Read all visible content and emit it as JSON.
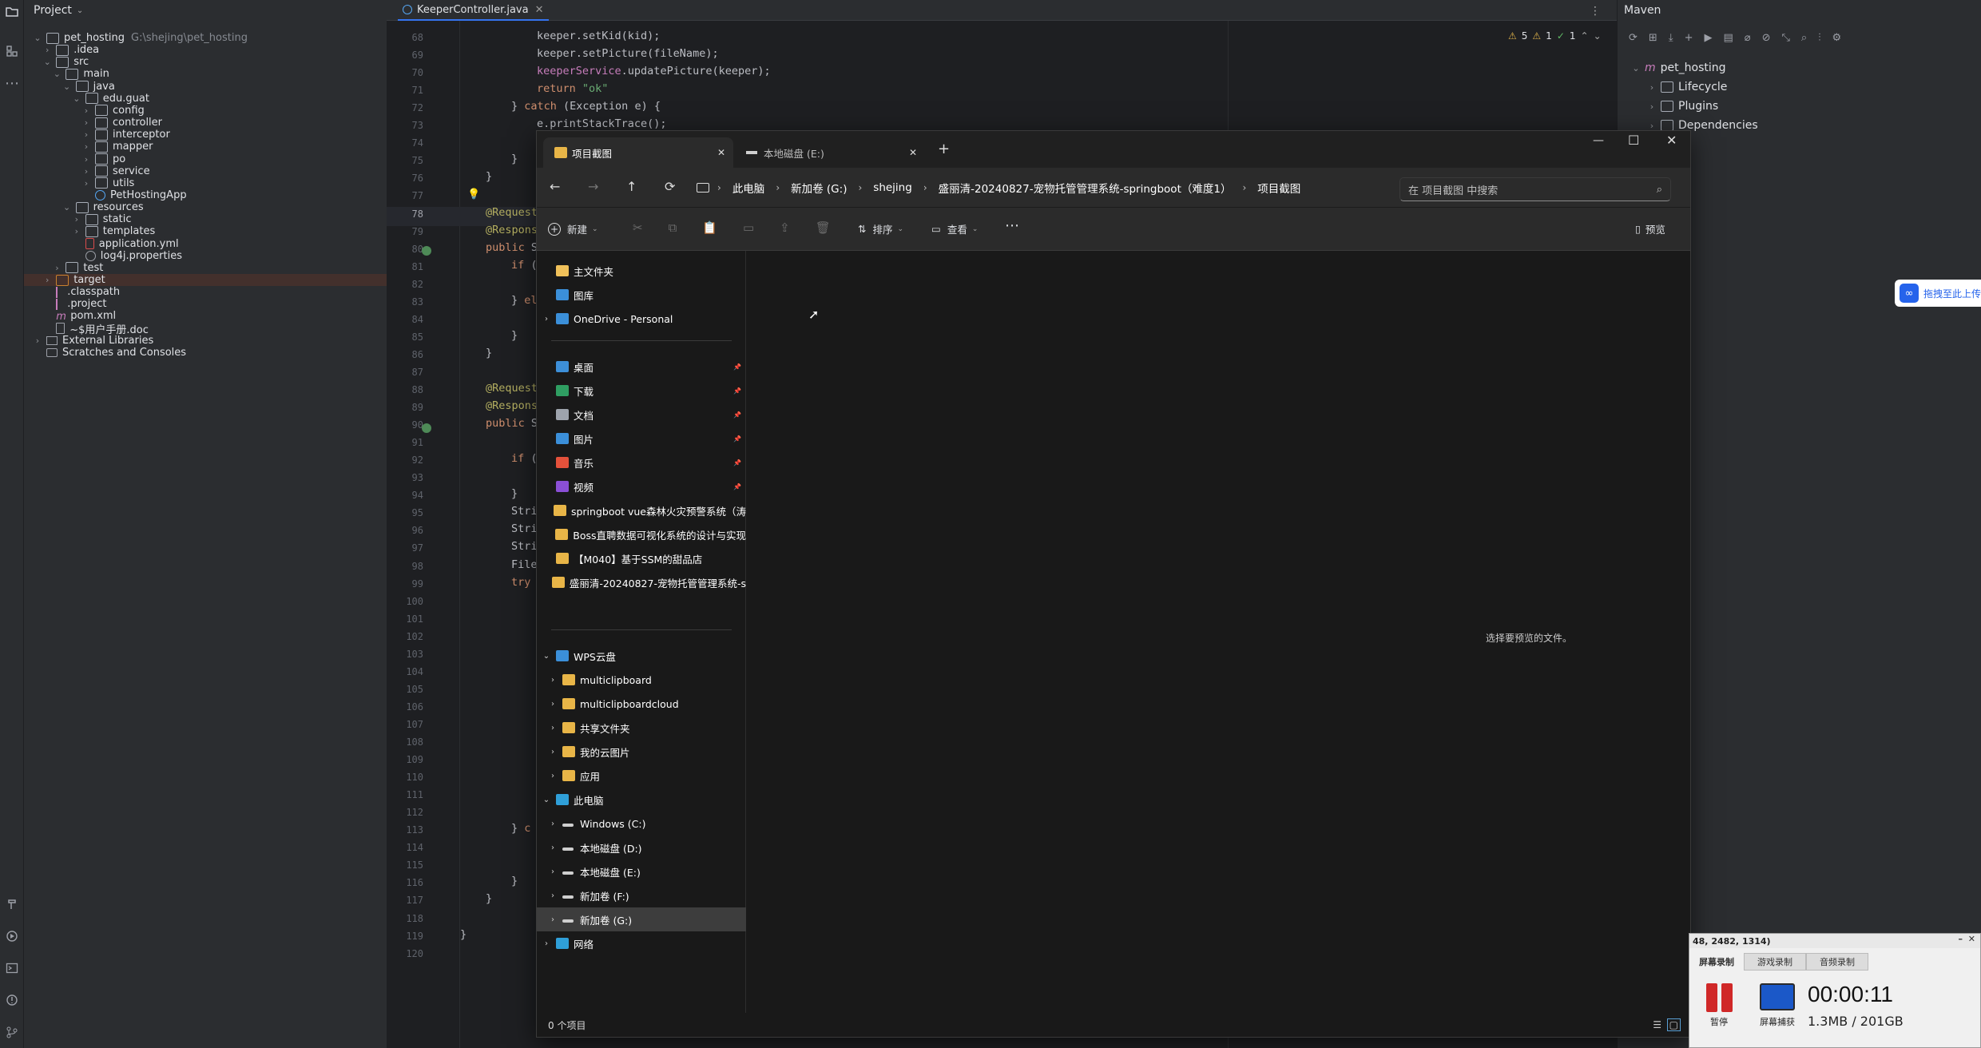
{
  "ide": {
    "project_label": "Project",
    "root": {
      "name": "pet_hosting",
      "path": "G:\\shejing\\pet_hosting"
    },
    "tree": [
      "pet_hosting",
      ".idea",
      "src",
      "main",
      "java",
      "edu.guat",
      "config",
      "controller",
      "interceptor",
      "mapper",
      "po",
      "service",
      "utils",
      "PetHostingApp",
      "resources",
      "static",
      "templates",
      "application.yml",
      "log4j.properties",
      "test",
      "target",
      ".classpath",
      ".project",
      "pom.xml",
      "~$用户手册.doc",
      "External Libraries",
      "Scratches and Consoles"
    ],
    "editor_tab": "KeeperController.java",
    "inspections": {
      "warnings": "5",
      "weak": "1",
      "ok": "1"
    },
    "line_numbers": [
      "68",
      "69",
      "70",
      "71",
      "72",
      "73",
      "74",
      "75",
      "76",
      "77",
      "78",
      "79",
      "80",
      "81",
      "82",
      "83",
      "84",
      "85",
      "86",
      "87",
      "88",
      "89",
      "90",
      "91",
      "92",
      "93",
      "94",
      "95",
      "96",
      "97",
      "98",
      "99",
      "100",
      "101",
      "102",
      "103",
      "104",
      "105",
      "106",
      "107",
      "108",
      "109",
      "110",
      "111",
      "112",
      "113",
      "114",
      "115",
      "116",
      "117",
      "118",
      "119",
      "120"
    ],
    "code": {
      "l68": "keeper.setKid(kid);",
      "l69": "keeper.setPicture(fileName);",
      "l70a": "keeperService",
      "l70b": ".updatePicture(keeper);",
      "l71a": "return ",
      "l71b": "\"ok\"",
      "l72a": "} ",
      "l72b": "catch",
      "l72c": " (Exception e) {",
      "l73": "e.printStackTrace();",
      "l75": "}",
      "l76": "}",
      "l78": "@Request",
      "l79": "@Respons",
      "l80a": "public",
      "l80b": " S",
      "l81a": "if",
      "l81b": " (",
      "l83a": "} ",
      "l83b": "el",
      "l85": "}",
      "l86": "}",
      "l88": "@Request",
      "l89": "@Respons",
      "l90a": "public",
      "l90b": " S",
      "l92a": "if",
      "l92b": " (",
      "l94": "}",
      "l95": "Stri",
      "l96": "Stri",
      "l97": "Stri",
      "l98": "File",
      "l99": "try",
      "l113a": "} ",
      "l113b": "c",
      "l116": "}",
      "l117": "}",
      "l119": "}"
    },
    "maven": {
      "title": "Maven",
      "root": "pet_hosting",
      "items": [
        "Lifecycle",
        "Plugins",
        "Dependencies"
      ]
    }
  },
  "explorer": {
    "tabs": [
      {
        "label": "项目截图",
        "active": true
      },
      {
        "label": "本地磁盘 (E:)",
        "active": false
      }
    ],
    "breadcrumb": [
      "此电脑",
      "新加卷 (G:)",
      "shejing",
      "盛丽清-20240827-宠物托管管理系统-springboot（难度1）",
      "项目截图"
    ],
    "search_placeholder": "在 项目截图 中搜索",
    "commands": {
      "new": "新建",
      "sort": "排序",
      "view": "查看",
      "preview": "预览"
    },
    "nav_top": [
      "主文件夹",
      "图库",
      "OneDrive - Personal"
    ],
    "quick_access": [
      "桌面",
      "下载",
      "文档",
      "图片",
      "音乐",
      "视频",
      "springboot vue森林火灾预警系统（涛",
      "Boss直聘数据可视化系统的设计与实现",
      "【M040】基于SSM的甜品店",
      "盛丽清-20240827-宠物托管管理系统-s"
    ],
    "wps": {
      "label": "WPS云盘",
      "items": [
        "multiclipboard",
        "multiclipboardcloud",
        "共享文件夹",
        "我的云图片",
        "应用"
      ]
    },
    "this_pc": {
      "label": "此电脑",
      "items": [
        "Windows (C:)",
        "本地磁盘 (D:)",
        "本地磁盘 (E:)",
        "新加卷 (F:)",
        "新加卷 (G:)"
      ]
    },
    "network": "网络",
    "empty_hint": "选择要预览的文件。",
    "status": "0 个项目"
  },
  "cloud_btn": "拖拽至此上传",
  "recorder": {
    "title": "48, 2482, 1314)",
    "tabs": [
      "屏幕录制",
      "游戏录制",
      "音频录制"
    ],
    "pause": "暂停",
    "capture": "屏幕捕获",
    "time": "00:00:11",
    "size": "1.3MB / 201GB"
  }
}
